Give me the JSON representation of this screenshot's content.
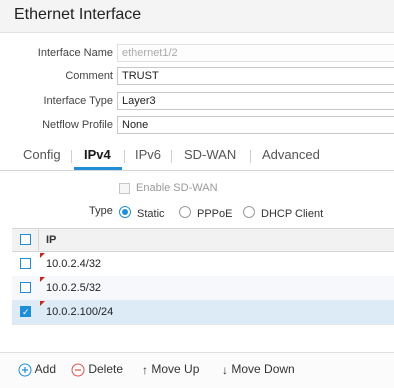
{
  "window": {
    "title": "Ethernet Interface"
  },
  "form": {
    "interface_name": {
      "label": "Interface Name",
      "value": "ethernet1/2"
    },
    "comment": {
      "label": "Comment",
      "value": "TRUST"
    },
    "interface_type": {
      "label": "Interface Type",
      "value": "Layer3"
    },
    "netflow_profile": {
      "label": "Netflow Profile",
      "value": "None"
    }
  },
  "tabs": [
    {
      "label": "Config"
    },
    {
      "label": "IPv4",
      "active": true
    },
    {
      "label": "IPv6"
    },
    {
      "label": "SD-WAN"
    },
    {
      "label": "Advanced"
    }
  ],
  "ipv4": {
    "enable_sdwan_label": "Enable SD-WAN",
    "type_label": "Type",
    "type_options": [
      "Static",
      "PPPoE",
      "DHCP Client"
    ],
    "type_selected": "Static"
  },
  "ip_table": {
    "header": "IP",
    "rows": [
      {
        "ip": "10.0.2.4/32",
        "checked": false
      },
      {
        "ip": "10.0.2.5/32",
        "checked": false
      },
      {
        "ip": "10.0.2.100/24",
        "checked": true
      }
    ]
  },
  "actions": {
    "add_label": "Add",
    "delete_label": "Delete",
    "move_up_label": "Move Up",
    "move_down_label": "Move Down"
  },
  "colors": {
    "accent": "#1e8fd6",
    "delete_red": "#d9534f",
    "marker_red": "#c42a1e"
  },
  "icons": [
    "plus-circle-icon",
    "minus-circle-icon",
    "arrow-up-icon",
    "arrow-down-icon",
    "checkmark-icon"
  ]
}
